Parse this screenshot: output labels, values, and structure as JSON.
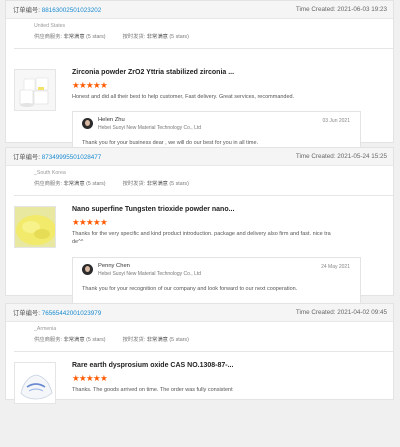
{
  "orders": [
    {
      "order_label": "订单编号:",
      "order_no": "88163002501023202",
      "time_label": "Time Created:",
      "time": "2021-06-03 19:23",
      "country": "United States",
      "supplier_label": "供应商服务:",
      "supplier_val": "非常满意",
      "supplier_stars": "(5 stars)",
      "ship_label": "按时发货:",
      "ship_val": "非常满意",
      "ship_stars": "(5 stars)",
      "product_title": "Zirconia powder ZrO2 Yttria stabilized zirconia ...",
      "stars": "★★★★★",
      "review": "Honest and did all their best to help customer, Fast delivery. Great services, recommanded.",
      "reply": {
        "name": "Helen Zhu",
        "company": "Hebei Suoyi New Material Technology Co., Ltd",
        "date": "03 Jun 2021",
        "text": "Thank you for your business dear , we will do our best for you in all time."
      }
    },
    {
      "order_label": "订单编号:",
      "order_no": "87349995501028477",
      "time_label": "Time Created:",
      "time": "2021-05-24 15:25",
      "country": "_South Korea",
      "supplier_label": "供应商服务:",
      "supplier_val": "非常满意",
      "supplier_stars": "(5 stars)",
      "ship_label": "按时发货:",
      "ship_val": "非常满意",
      "ship_stars": "(5 stars)",
      "product_title": "Nano superfine Tungsten trioxide powder nano...",
      "stars": "★★★★★",
      "review_line1": "Thanks for the very specific and kind product introduction. package and delivery also firm and fast. nice tra",
      "review_line2": "de^^",
      "reply": {
        "name": "Penny Chen",
        "company": "Hebei Suoyi New Material Technology Co., Ltd",
        "date": "24 May 2021",
        "text": "Thank you for your recognition of our company and look forward to our next cooperation."
      }
    },
    {
      "order_label": "订单编号:",
      "order_no": "76565442001023979",
      "time_label": "Time Created:",
      "time": "2021-04-02 09:45",
      "country": "_Armenia",
      "supplier_label": "供应商服务:",
      "supplier_val": "非常满意",
      "supplier_stars": "(5 stars)",
      "ship_label": "按时发货:",
      "ship_val": "非常满意",
      "ship_stars": "(5 stars)",
      "product_title": "Rare earth dysprosium oxide CAS NO.1308-87-...",
      "stars": "★★★★★",
      "review": "Thanks. The goods arrived on time. The order was fully consistent"
    }
  ]
}
